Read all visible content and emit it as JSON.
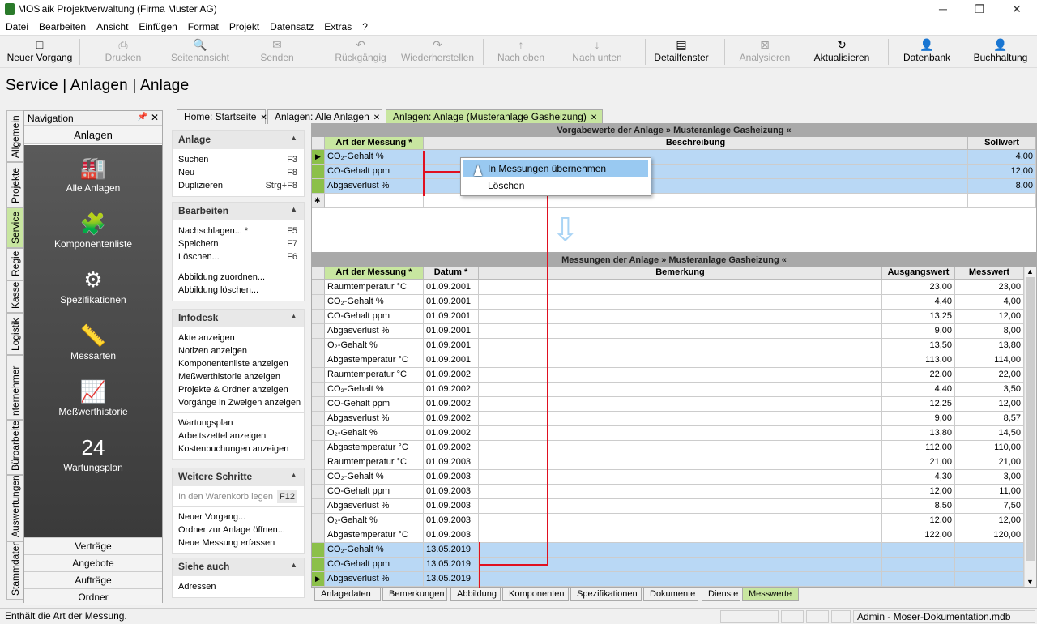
{
  "window": {
    "title": "MOS'aik Projektverwaltung (Firma Muster AG)",
    "minimize": "─",
    "restore": "❐",
    "close": "✕"
  },
  "menu": [
    "Datei",
    "Bearbeiten",
    "Ansicht",
    "Einfügen",
    "Format",
    "Projekt",
    "Datensatz",
    "Extras",
    "?"
  ],
  "toolbar": [
    {
      "label": "Neuer Vorgang",
      "icon": "□",
      "enabled": true
    },
    {
      "label": "Drucken",
      "icon": "⎙",
      "enabled": false
    },
    {
      "label": "Seitenansicht",
      "icon": "🔍",
      "enabled": false
    },
    {
      "label": "Senden",
      "icon": "✉",
      "enabled": false
    },
    {
      "label": "Rückgängig",
      "icon": "↶",
      "enabled": false
    },
    {
      "label": "Wiederherstellen",
      "icon": "↷",
      "enabled": false
    },
    {
      "label": "Nach oben",
      "icon": "↑",
      "enabled": false
    },
    {
      "label": "Nach unten",
      "icon": "↓",
      "enabled": false
    },
    {
      "label": "Detailfenster",
      "icon": "▤",
      "enabled": true
    },
    {
      "label": "Analysieren",
      "icon": "⊠",
      "enabled": false
    },
    {
      "label": "Aktualisieren",
      "icon": "↻",
      "enabled": true
    },
    {
      "label": "Datenbank",
      "icon": "👤",
      "enabled": true
    },
    {
      "label": "Buchhaltung",
      "icon": "👤",
      "enabled": true
    }
  ],
  "page_title": "Service | Anlagen | Anlage",
  "vertical_tabs": [
    "Allgemein",
    "Projekte",
    "Service",
    "Regie",
    "Kasse",
    "Logistik",
    "nternehmer",
    "Büroarbeiten",
    "Auswertungen",
    "Stammdaten"
  ],
  "navigation": {
    "header": "Navigation",
    "pin": "📌",
    "close": "✕",
    "section": "Anlagen",
    "items": [
      {
        "label": "Alle Anlagen",
        "icon": "🏭"
      },
      {
        "label": "Komponentenliste",
        "icon": "🧩"
      },
      {
        "label": "Spezifikationen",
        "icon": "⚙"
      },
      {
        "label": "Messarten",
        "icon": "📏"
      },
      {
        "label": "Meßwerthistorie",
        "icon": "📈"
      },
      {
        "label": "Wartungsplan",
        "icon": "24"
      }
    ],
    "buttons": [
      "Verträge",
      "Angebote",
      "Aufträge",
      "Ordner"
    ]
  },
  "taskpane": [
    {
      "title": "Anlage",
      "chev": "▲",
      "rows": [
        [
          "Suchen",
          "F3"
        ],
        [
          "Neu",
          "F8"
        ],
        [
          "Duplizieren",
          "Strg+F8"
        ]
      ]
    },
    {
      "title": "Bearbeiten",
      "chev": "▲",
      "rows": [
        [
          "Nachschlagen... *",
          "F5"
        ],
        [
          "Speichern",
          "F7"
        ],
        [
          "Löschen...",
          "F6"
        ],
        [
          "---",
          ""
        ],
        [
          "Abbildung zuordnen...",
          ""
        ],
        [
          "Abbildung löschen...",
          ""
        ]
      ]
    },
    {
      "title": "Infodesk",
      "chev": "▲",
      "rows": [
        [
          "Akte anzeigen",
          ""
        ],
        [
          "Notizen anzeigen",
          ""
        ],
        [
          "Komponentenliste anzeigen",
          ""
        ],
        [
          "Meßwerthistorie anzeigen",
          ""
        ],
        [
          "Projekte & Ordner anzeigen",
          ""
        ],
        [
          "Vorgänge in Zweigen anzeigen",
          ""
        ],
        [
          "---",
          ""
        ],
        [
          "Wartungsplan",
          ""
        ],
        [
          "Arbeitszettel anzeigen",
          ""
        ],
        [
          "Kostenbuchungen anzeigen",
          ""
        ]
      ]
    },
    {
      "title": "Weitere Schritte",
      "chev": "▲",
      "rows": [
        [
          "In den Warenkorb legen",
          "F12"
        ],
        [
          "---",
          ""
        ],
        [
          "Neuer Vorgang...",
          ""
        ],
        [
          "Ordner zur Anlage öffnen...",
          ""
        ],
        [
          "Neue Messung erfassen",
          ""
        ]
      ]
    },
    {
      "title": "Siehe auch",
      "chev": "▲",
      "rows": [
        [
          "Adressen",
          ""
        ]
      ]
    }
  ],
  "doc_tabs": [
    "Home: Startseite",
    "Anlagen: Alle Anlagen",
    "Anlagen: Anlage (Musteranlage Gasheizung)"
  ],
  "doc_tab_close": "✕",
  "grid1": {
    "caption": "Vorgabewerte der Anlage » Musteranlage Gasheizung «",
    "headers": [
      "Art der Messung *",
      "Beschreibung",
      "Sollwert"
    ],
    "rows": [
      [
        "CO₂-Gehalt %",
        "",
        "4,00"
      ],
      [
        "CO-Gehalt ppm",
        "",
        "12,00"
      ],
      [
        "Abgasverlust %",
        "",
        "8,00"
      ]
    ],
    "new_row_marker": "✱",
    "current_marker": "▶"
  },
  "context_menu": [
    "In Messungen übernehmen",
    "Löschen"
  ],
  "arrow_glyph": "⇩",
  "grid2": {
    "caption": "Messungen der Anlage » Musteranlage Gasheizung «",
    "headers": [
      "Art der Messung *",
      "Datum *",
      "Bemerkung",
      "Ausgangswert",
      "Messwert"
    ],
    "rows": [
      [
        "Raumtemperatur °C",
        "01.09.2001",
        "",
        "23,00",
        "23,00"
      ],
      [
        "CO₂-Gehalt %",
        "01.09.2001",
        "",
        "4,40",
        "4,00"
      ],
      [
        "CO-Gehalt ppm",
        "01.09.2001",
        "",
        "13,25",
        "12,00"
      ],
      [
        "Abgasverlust %",
        "01.09.2001",
        "",
        "9,00",
        "8,00"
      ],
      [
        "O₂-Gehalt %",
        "01.09.2001",
        "",
        "13,50",
        "13,80"
      ],
      [
        "Abgastemperatur °C",
        "01.09.2001",
        "",
        "113,00",
        "114,00"
      ],
      [
        "Raumtemperatur °C",
        "01.09.2002",
        "",
        "22,00",
        "22,00"
      ],
      [
        "CO₂-Gehalt %",
        "01.09.2002",
        "",
        "4,40",
        "3,50"
      ],
      [
        "CO-Gehalt ppm",
        "01.09.2002",
        "",
        "12,25",
        "12,00"
      ],
      [
        "Abgasverlust %",
        "01.09.2002",
        "",
        "9,00",
        "8,57"
      ],
      [
        "O₂-Gehalt %",
        "01.09.2002",
        "",
        "13,80",
        "14,50"
      ],
      [
        "Abgastemperatur °C",
        "01.09.2002",
        "",
        "112,00",
        "110,00"
      ],
      [
        "Raumtemperatur °C",
        "01.09.2003",
        "",
        "21,00",
        "21,00"
      ],
      [
        "CO₂-Gehalt %",
        "01.09.2003",
        "",
        "4,30",
        "3,00"
      ],
      [
        "CO-Gehalt ppm",
        "01.09.2003",
        "",
        "12,00",
        "11,00"
      ],
      [
        "Abgasverlust %",
        "01.09.2003",
        "",
        "8,50",
        "7,50"
      ],
      [
        "O₂-Gehalt %",
        "01.09.2003",
        "",
        "12,00",
        "12,00"
      ],
      [
        "Abgastemperatur °C",
        "01.09.2003",
        "",
        "122,00",
        "120,00"
      ],
      [
        "CO₂-Gehalt %",
        "13.05.2019",
        "",
        "",
        ""
      ],
      [
        "CO-Gehalt ppm",
        "13.05.2019",
        "",
        "",
        ""
      ],
      [
        "Abgasverlust %",
        "13.05.2019",
        "",
        "",
        ""
      ]
    ],
    "scroll_up": "▲",
    "scroll_down": "▼"
  },
  "bottom_tabs": [
    "Anlagedaten",
    "Bemerkungen",
    "Abbildung",
    "Komponenten",
    "Spezifikationen",
    "Dokumente",
    "Dienste",
    "Messwerte"
  ],
  "status": {
    "text": "Enthält die Art der Messung.",
    "right": "Admin - Moser-Dokumentation.mdb"
  },
  "colors": {
    "accent_green": "#c8e6a0",
    "selection": "#b9d8f5",
    "annotation_red": "#e01020",
    "nav_dark": "#4a4a4a"
  }
}
